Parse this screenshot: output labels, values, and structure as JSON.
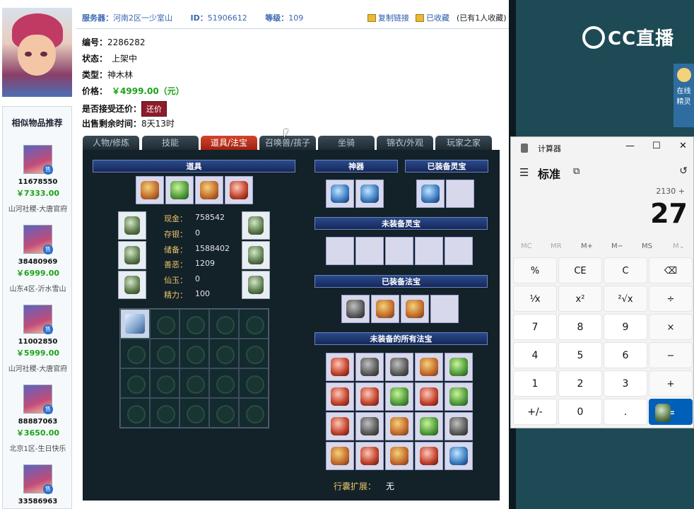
{
  "header": {
    "server_label": "服务器：",
    "server_value": "河南2区一少室山",
    "id_label": "ID：",
    "id_value": "51906612",
    "level_label": "等级：",
    "level_value": "109",
    "copy_link": "复制链接",
    "favorited": "已收藏",
    "favorite_count": "(已有1人收藏)"
  },
  "info": {
    "serial_label": "编号：",
    "serial_value": "2286282",
    "status_label": "状态：",
    "status_value": "上架中",
    "type_label": "类型：",
    "type_value": "神木林",
    "price_label": "价格：",
    "price_value": "￥4999.00（元）",
    "haggle_label": "是否接受还价：",
    "haggle_button": "还价",
    "remaining_label": "出售剩余时间：",
    "remaining_value": "8天13时"
  },
  "similar": {
    "title": "相似物品推荐",
    "sale_badge": "售",
    "items": [
      {
        "id": "11678550",
        "price": "￥7333.00",
        "server": "山河社稷-大唐官府"
      },
      {
        "id": "38480969",
        "price": "￥6999.00",
        "server": "山东4区-沂水雪山"
      },
      {
        "id": "11002850",
        "price": "￥5999.00",
        "server": "山河社稷-大唐官府"
      },
      {
        "id": "88887063",
        "price": "￥3650.00",
        "server": "北京1区-生日快乐"
      },
      {
        "id": "33586963",
        "price": "",
        "server": ""
      }
    ]
  },
  "tabs": [
    "人物/修炼",
    "技能",
    "道具/法宝",
    "召唤兽/孩子",
    "坐骑",
    "锦衣/外观",
    "玩家之家"
  ],
  "active_tab": "道具/法宝",
  "panel": {
    "items_header": "道具",
    "artifact_header": "神器",
    "equipped_spirit_header": "已装备灵宝",
    "unequipped_spirit_header": "未装备灵宝",
    "equipped_treasure_header": "已装备法宝",
    "unequipped_treasure_header": "未装备的所有法宝",
    "stats": [
      {
        "key": "现金：",
        "value": "758542"
      },
      {
        "key": "存银：",
        "value": "0"
      },
      {
        "key": "储备：",
        "value": "1588402"
      },
      {
        "key": "善恶：",
        "value": "1209"
      },
      {
        "key": "仙玉：",
        "value": "0"
      },
      {
        "key": "精力：",
        "value": "100"
      }
    ],
    "bag_label": "行囊扩展：",
    "bag_value": "无"
  },
  "desktop": {
    "cc_logo": "CC直播",
    "widget_line1": "在线",
    "widget_line2": "精灵"
  },
  "calculator": {
    "window_title": "计算器",
    "mode": "标准",
    "expression": "2130 +",
    "display": "27",
    "memory": [
      "MC",
      "MR",
      "M+",
      "M−",
      "MS",
      "M⌄"
    ],
    "keys": [
      [
        "%",
        "CE",
        "C",
        "⌫"
      ],
      [
        "⅟x",
        "x²",
        "²√x",
        "÷"
      ],
      [
        "7",
        "8",
        "9",
        "×"
      ],
      [
        "4",
        "5",
        "6",
        "−"
      ],
      [
        "1",
        "2",
        "3",
        "+"
      ],
      [
        "+/-",
        "0",
        ".",
        "="
      ]
    ]
  }
}
